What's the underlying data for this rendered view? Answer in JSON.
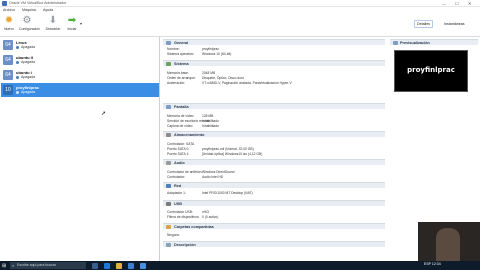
{
  "window": {
    "title": "Oracle VM VirtualBox Administrador",
    "controls": {
      "minimize": "—",
      "maximize": "☐",
      "close": "✕"
    }
  },
  "menu": [
    "Archivo",
    "Máquina",
    "Ayuda"
  ],
  "toolbar": {
    "nuevo": "Nuevo",
    "configuracion": "Configuración",
    "descartar": "Descartar",
    "iniciar": "Iniciar",
    "detalles": "Detalles",
    "instantaneas": "Instantáneas"
  },
  "vm_list": [
    {
      "name": "Linux",
      "state": "Apagada",
      "selected": false
    },
    {
      "name": "ubuntu II",
      "state": "Apagada",
      "selected": false
    },
    {
      "name": "ubuntu i",
      "state": "Apagada",
      "selected": false
    },
    {
      "name": "proyfinlprac",
      "state": "Apagada",
      "selected": true
    }
  ],
  "details": {
    "general": {
      "title": "General",
      "rows": [
        {
          "label": "Nombre:",
          "value": "proyfinlprac"
        },
        {
          "label": "Sistema operativo:",
          "value": "Windows 10 (64-bit)"
        }
      ]
    },
    "sistema": {
      "title": "Sistema",
      "rows": [
        {
          "label": "Memoria base:",
          "value": "2048 MB"
        },
        {
          "label": "Orden de arranque:",
          "value": "Disquete, Óptico, Disco duro"
        },
        {
          "label": "Aceleración:",
          "value": "VT-x/AMD-V, Paginación anidada, Paravirtualización Hyper-V"
        }
      ]
    },
    "pantalla": {
      "title": "Pantalla",
      "rows": [
        {
          "label": "Memoria de vídeo:",
          "value": "128 MB"
        },
        {
          "label": "Servidor de escritorio remoto:",
          "value": "Inhabilitado"
        },
        {
          "label": "Captura de vídeo:",
          "value": "Inhabilitado"
        }
      ]
    },
    "almacenamiento": {
      "title": "Almacenamiento",
      "rows": [
        {
          "label": "Controlador: SATA",
          "value": ""
        },
        {
          "label": "Puerto SATA 0:",
          "value": "proyfinlprac.vdi (Normal, 32,00 GB)"
        },
        {
          "label": "Puerto SATA 1:",
          "value": "[Unidad óptica] Windows10.iso (4,12 GB)"
        }
      ]
    },
    "audio": {
      "title": "Audio",
      "rows": [
        {
          "label": "Controlador de anfitrión:",
          "value": "Windows DirectSound"
        },
        {
          "label": "Controlador:",
          "value": "Audio Intel HD"
        }
      ]
    },
    "red": {
      "title": "Red",
      "rows": [
        {
          "label": "Adaptador 1:",
          "value": "Intel PRO/1000 MT Desktop (NAT)"
        }
      ]
    },
    "usb": {
      "title": "USB",
      "rows": [
        {
          "label": "Controlador USB:",
          "value": "xHCI"
        },
        {
          "label": "Filtros de dispositivos:",
          "value": "0 (0 activo)"
        }
      ]
    },
    "carpetas": {
      "title": "Carpetas compartidas",
      "rows": [
        {
          "label": "Ninguno",
          "value": ""
        }
      ]
    },
    "descripcion": {
      "title": "Descripción",
      "rows": []
    }
  },
  "preview": {
    "title": "Previsualización",
    "screen_text": "proyfinlprac"
  },
  "taskbar": {
    "search_placeholder": "Escribe aquí para buscar",
    "tray_text": "ESP  12:34"
  },
  "colors": {
    "selection": "#3a8ee6",
    "section_header": "#e8edf3",
    "taskbar": "#0d1b2a"
  }
}
